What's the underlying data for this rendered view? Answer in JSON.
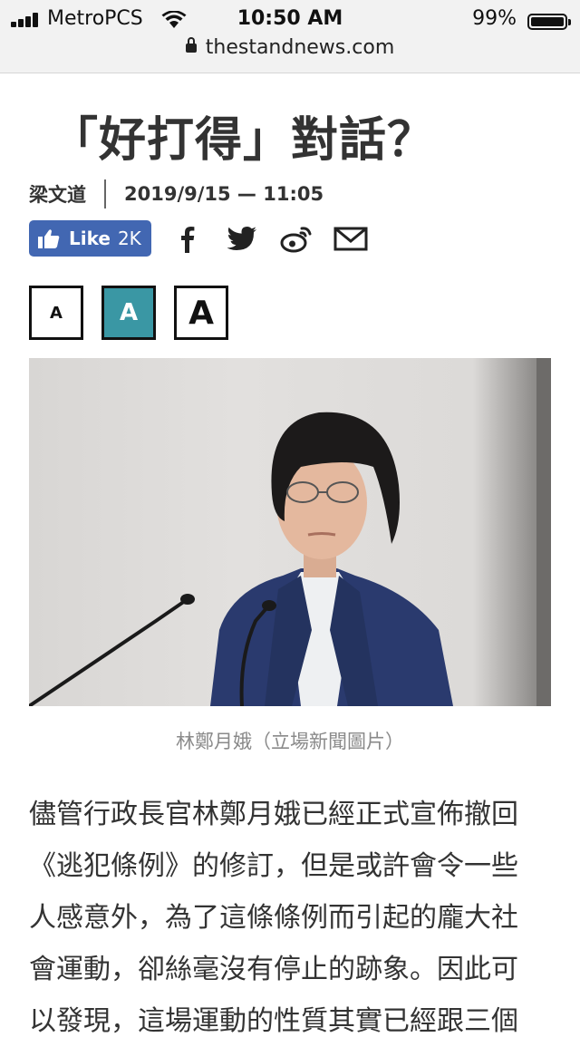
{
  "status_bar": {
    "carrier": "MetroPCS",
    "time": "10:50 AM",
    "battery_percent": "99%",
    "battery_level": 0.99,
    "url": "thestandnews.com"
  },
  "article": {
    "title": "「好打得」對話？",
    "author": "梁文道",
    "datetime": "2019/9/15 — 11:05",
    "like_label": "Like",
    "like_count": "2K",
    "font_buttons": [
      "A",
      "A",
      "A"
    ],
    "image_caption": "林鄭月娥（立場新聞圖片）",
    "body_lines": [
      "儘管行政長官林鄭月娥已經正式宣佈撤回",
      "《逃犯條例》的修訂，但是或許會令一些",
      "人感意外，為了這條條例而引起的龐大社",
      "會運動，卻絲毫沒有停止的跡象。因此可",
      "以發現，這場運動的性質其實已經跟三個"
    ]
  },
  "share_icons": [
    "facebook-icon",
    "twitter-icon",
    "weibo-icon",
    "email-icon"
  ],
  "colors": {
    "facebook_blue": "#4267b2",
    "font_button_active": "#3a97a4"
  }
}
